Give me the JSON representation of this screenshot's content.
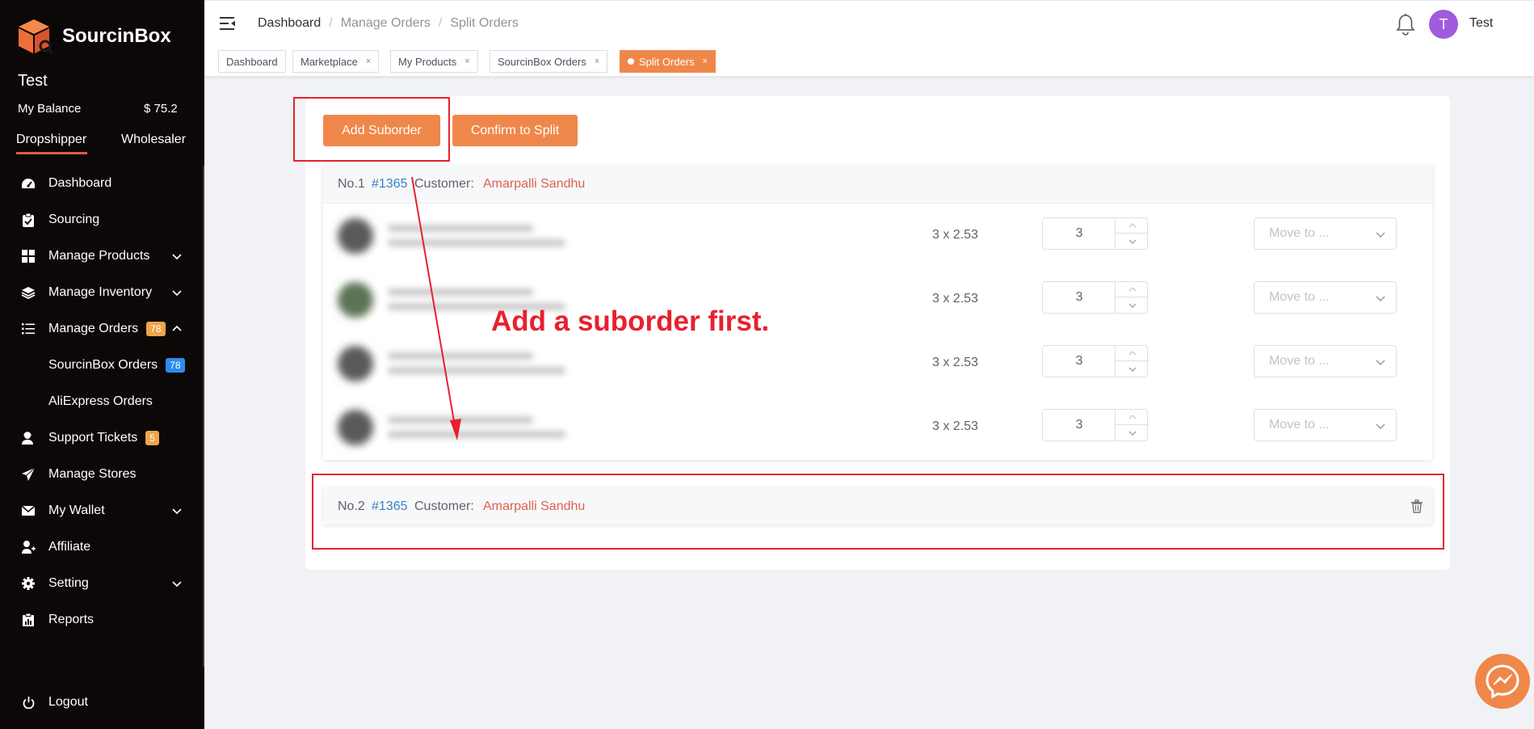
{
  "sidebar": {
    "brand": "SourcinBox",
    "user_name": "Test",
    "balance_label": "My Balance",
    "balance_value": "$ 75.2",
    "roles": [
      "Dropshipper",
      "Wholesaler"
    ],
    "items": [
      {
        "label": "Dashboard",
        "icon": "dashboard-icon"
      },
      {
        "label": "Sourcing",
        "icon": "clipboard-check-icon"
      },
      {
        "label": "Manage Products",
        "icon": "grid-icon"
      },
      {
        "label": "Manage Inventory",
        "icon": "layers-icon"
      },
      {
        "label": "Manage Orders",
        "icon": "list-icon",
        "badge": "78"
      },
      {
        "label": "SourcinBox Orders",
        "badge": "78"
      },
      {
        "label": "AliExpress Orders"
      },
      {
        "label": "Support Tickets",
        "icon": "support-person-icon",
        "badge": "5"
      },
      {
        "label": "Manage Stores",
        "icon": "paper-plane-icon"
      },
      {
        "label": "My Wallet",
        "icon": "envelope-icon"
      },
      {
        "label": "Affiliate",
        "icon": "user-add-icon"
      },
      {
        "label": "Setting",
        "icon": "gear-icon"
      },
      {
        "label": "Reports",
        "icon": "report-icon"
      },
      {
        "label": "Logout",
        "icon": "power-icon"
      }
    ]
  },
  "header": {
    "breadcrumb": [
      "Dashboard",
      "Manage Orders",
      "Split Orders"
    ],
    "separator": "/",
    "avatar_letter": "T",
    "user": "Test"
  },
  "tabs": [
    {
      "label": "Dashboard"
    },
    {
      "label": "Marketplace"
    },
    {
      "label": "My Products"
    },
    {
      "label": "SourcinBox Orders"
    },
    {
      "label": "Split Orders",
      "active": true
    }
  ],
  "tab_close": "×",
  "actions": {
    "add_suborder": "Add Suborder",
    "confirm_split": "Confirm to Split"
  },
  "suborders": [
    {
      "no": "No.1",
      "order_id": "#1365",
      "customer_label": "Customer:",
      "customer_name": "Amarpalli Sandhu",
      "items": [
        {
          "price": "3 x 2.53",
          "qty": "3",
          "move_placeholder": "Move to ..."
        },
        {
          "price": "3 x 2.53",
          "qty": "3",
          "move_placeholder": "Move to ..."
        },
        {
          "price": "3 x 2.53",
          "qty": "3",
          "move_placeholder": "Move to ..."
        },
        {
          "price": "3 x 2.53",
          "qty": "3",
          "move_placeholder": "Move to ..."
        }
      ]
    },
    {
      "no": "No.2",
      "order_id": "#1365",
      "customer_label": "Customer:",
      "customer_name": "Amarpalli Sandhu",
      "items": []
    }
  ],
  "annotation": "Add a suborder first.",
  "colors": {
    "accent": "#f0874a",
    "sidebar_bg": "#0c0807",
    "link": "#3a80c6",
    "customer": "#e0604d",
    "annotation": "#e8202e",
    "badge_orange": "#f0a44c",
    "badge_blue": "#2d8cf0",
    "avatar": "#a05bdc"
  }
}
